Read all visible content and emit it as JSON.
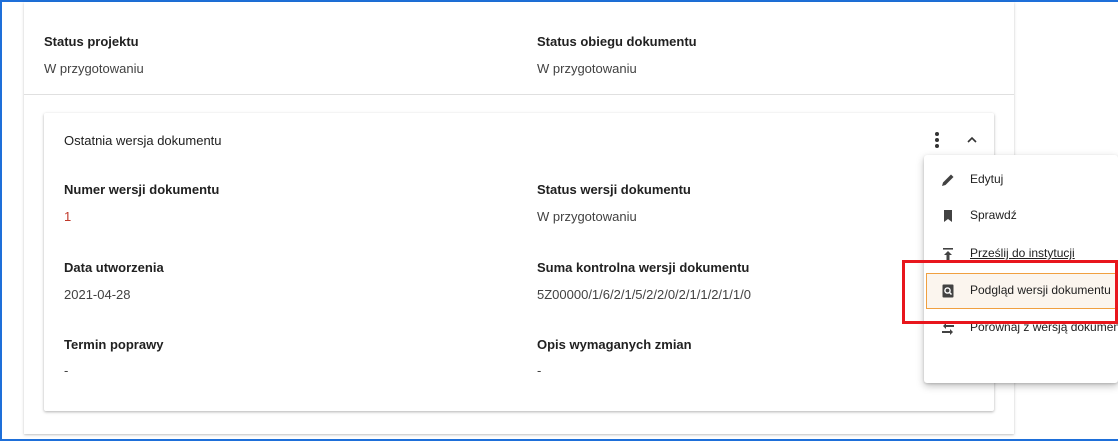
{
  "project": {
    "status_label": "Status projektu",
    "status_value": "W przygotowaniu",
    "flow_label": "Status obiegu dokumentu",
    "flow_value": "W przygotowaniu"
  },
  "version_card": {
    "title": "Ostatnia wersja dokumentu",
    "number_label": "Numer wersji dokumentu",
    "number_value": "1",
    "version_status_label": "Status wersji dokumentu",
    "version_status_value": "W przygotowaniu",
    "created_label": "Data utworzenia",
    "created_value": "2021-04-28",
    "checksum_label": "Suma kontrolna wersji dokumentu",
    "checksum_value": "5Z00000/1/6/2/1/5/2/2/0/2/1/1/2/1/1/0",
    "deadline_label": "Termin poprawy",
    "deadline_value": "-",
    "changes_label": "Opis wymaganych zmian",
    "changes_value": "-"
  },
  "menu": {
    "items": [
      {
        "label": "Edytuj",
        "icon": "pencil-icon"
      },
      {
        "label": "Sprawdź",
        "icon": "bookmark-icon"
      },
      {
        "label": "Prześlij do instytucji",
        "icon": "upload-icon"
      },
      {
        "label": "Podgląd wersji dokumentu",
        "icon": "preview-icon"
      },
      {
        "label": "Porównaj z wersją dokumentu",
        "icon": "compare-icon"
      }
    ]
  },
  "colors": {
    "frame": "#1e6fd9",
    "highlight_red": "#e8161c",
    "highlight_orange": "#f0a040"
  }
}
